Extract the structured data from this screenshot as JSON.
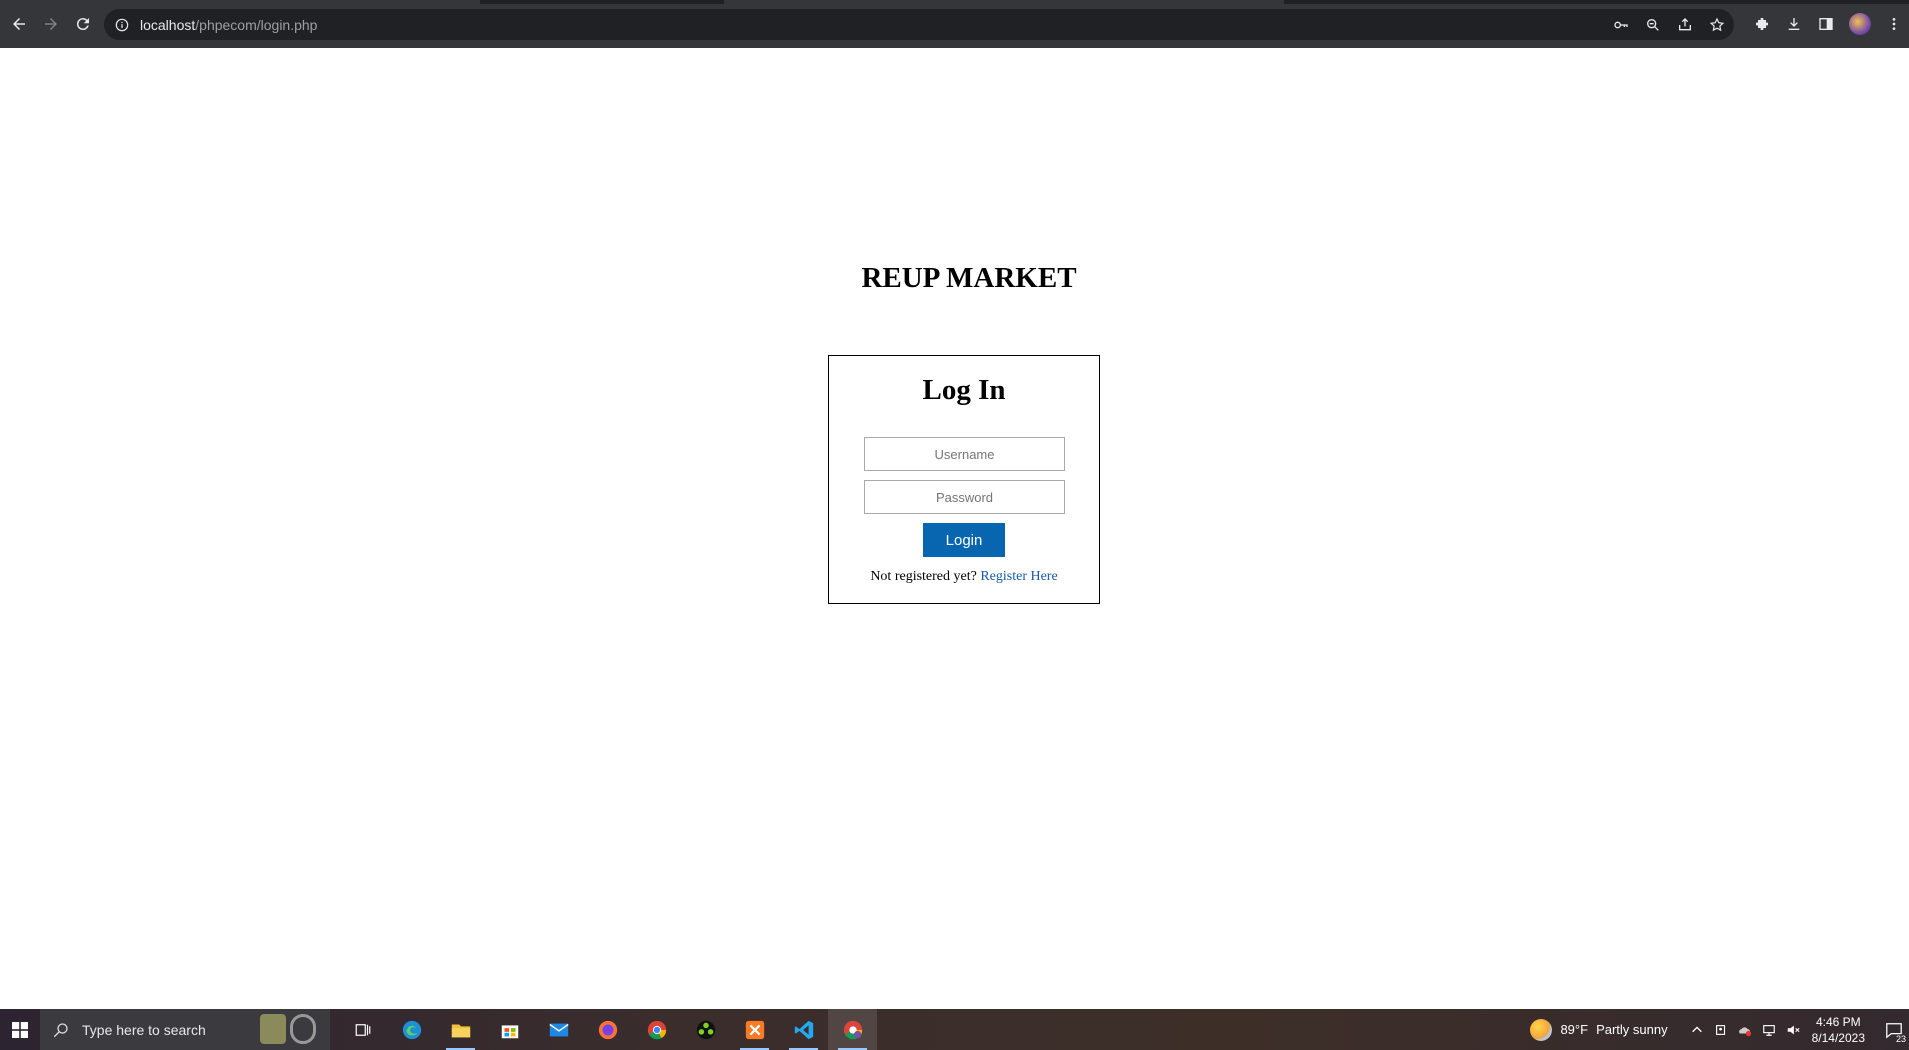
{
  "browser": {
    "url_host": "localhost",
    "url_path": "/phpecom/login.php"
  },
  "page": {
    "site_title": "REUP MARKET",
    "login_heading": "Log In",
    "username_placeholder": "Username",
    "password_placeholder": "Password",
    "login_button": "Login",
    "register_prompt": "Not registered yet?",
    "register_link": "Register Here"
  },
  "taskbar": {
    "search_placeholder": "Type here to search",
    "weather_temp": "89°F",
    "weather_desc": "Partly sunny",
    "time": "4:46 PM",
    "date": "8/14/2023",
    "notification_count": "23",
    "apps": [
      "task-view",
      "edge",
      "file-explorer",
      "microsoft-store",
      "mail",
      "firefox",
      "chrome",
      "app-green",
      "xampp",
      "vscode",
      "chrome-dev"
    ]
  },
  "colors": {
    "chrome_bar": "#35363a",
    "omnibox": "#202124",
    "login_button": "#0866b1",
    "link": "#1a5ca8"
  }
}
